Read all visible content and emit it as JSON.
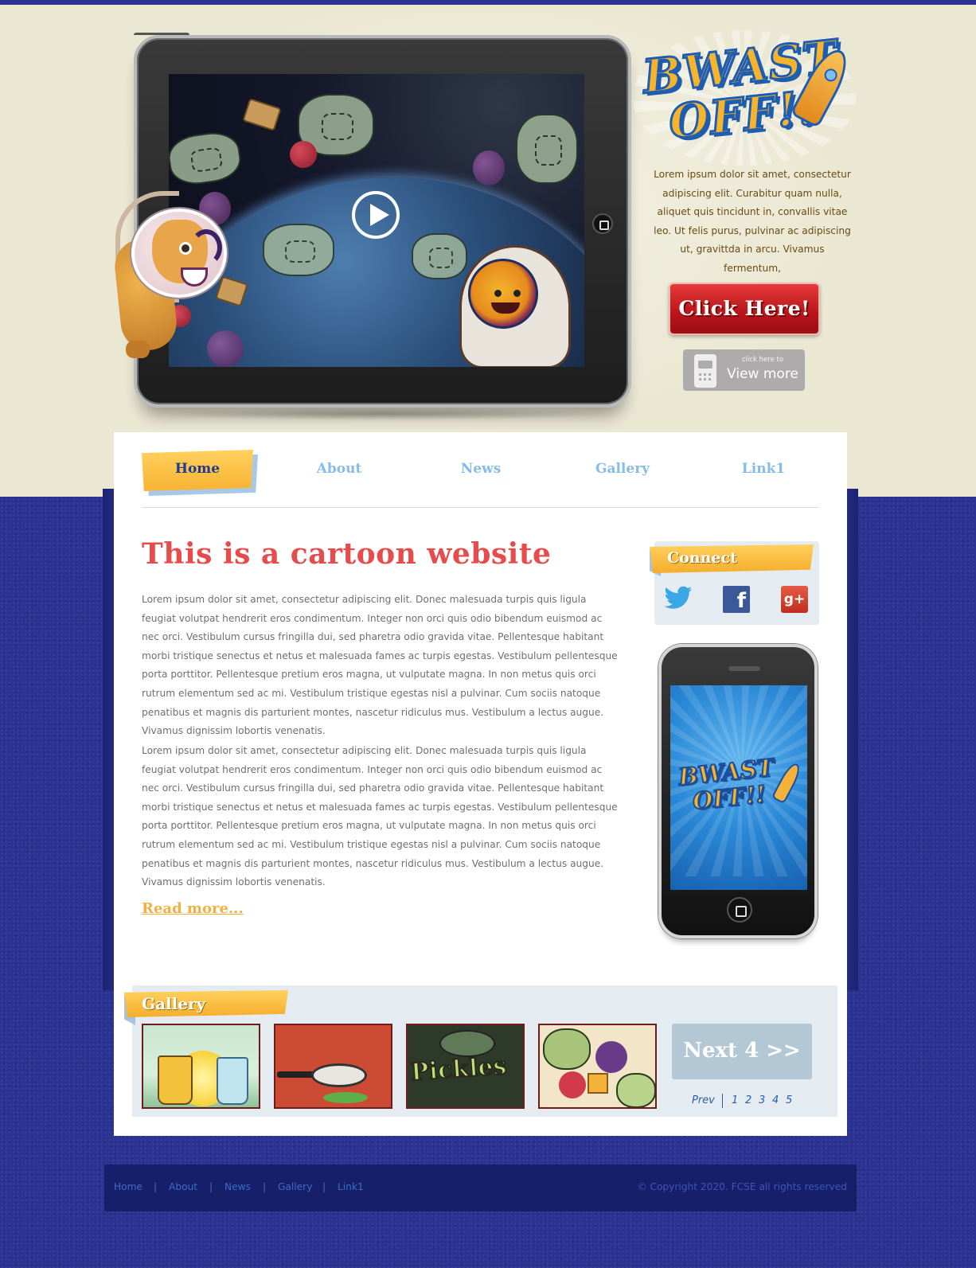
{
  "hero": {
    "logo_line1": "BWAST",
    "logo_line2": "OFF!!",
    "description": "Lorem ipsum dolor sit amet, consectetur adipiscing elit. Curabitur quam nulla, aliquet quis tincidunt in, convallis vitae leo. Ut felis purus, pulvinar ac adipiscing ut, gravittda in arcu. Vivamus fermentum,",
    "click_button": "Click Here!",
    "view_more_small": "click here to",
    "view_more_big": "View more"
  },
  "nav": {
    "items": [
      {
        "label": "Home"
      },
      {
        "label": "About"
      },
      {
        "label": "News"
      },
      {
        "label": "Gallery"
      },
      {
        "label": "Link1"
      }
    ],
    "active": "Home"
  },
  "main": {
    "title": "This is a cartoon website",
    "paragraph1": "Lorem ipsum dolor sit amet, consectetur adipiscing elit. Donec malesuada turpis quis ligula feugiat volutpat hendrerit eros condimentum. Integer non orci quis odio bibendum euismod ac nec orci. Vestibulum cursus fringilla dui, sed pharetra odio gravida vitae. Pellentesque habitant morbi tristique senectus et netus et malesuada fames ac turpis egestas. Vestibulum pellentesque porta porttitor. Pellentesque pretium eros magna, ut vulputate magna. In non metus quis orci rutrum elementum sed ac mi. Vestibulum tristique egestas nisl a pulvinar. Cum sociis natoque penatibus et magnis dis parturient montes, nascetur ridiculus mus. Vestibulum a lectus augue. Vivamus dignissim lobortis venenatis.",
    "paragraph2": "Lorem ipsum dolor sit amet, consectetur adipiscing elit. Donec malesuada turpis quis ligula feugiat volutpat hendrerit eros condimentum. Integer non orci quis odio bibendum euismod ac nec orci. Vestibulum cursus fringilla dui, sed pharetra odio gravida vitae. Pellentesque habitant morbi tristique senectus et netus et malesuada fames ac turpis egestas. Vestibulum pellentesque porta porttitor. Pellentesque pretium eros magna, ut vulputate magna. In non metus quis orci rutrum elementum sed ac mi. Vestibulum tristique egestas nisl a pulvinar. Cum sociis natoque penatibus et magnis dis parturient montes, nascetur ridiculus mus. Vestibulum a lectus augue. Vivamus dignissim lobortis venenatis.",
    "read_more": "Read more..."
  },
  "sidebar": {
    "connect_title": "Connect",
    "social": [
      {
        "name": "twitter-icon"
      },
      {
        "name": "facebook-icon",
        "glyph": "f"
      },
      {
        "name": "google-plus-icon",
        "glyph": "g+"
      }
    ],
    "phone_logo_line1": "BWAST",
    "phone_logo_line2": "OFF!!"
  },
  "gallery": {
    "title": "Gallery",
    "thumb3_text": "Pickles",
    "next_label": "Next 4 >>",
    "prev_label": "Prev",
    "pages": [
      "1",
      "2",
      "3",
      "4",
      "5"
    ]
  },
  "footer": {
    "links": [
      "Home",
      "About",
      "News",
      "Gallery",
      "Link1"
    ],
    "separator": "|",
    "copyright": "© Copyright 2020. FCSE all rights reserved"
  },
  "colors": {
    "background_blue": "#2a3392",
    "hero_cream": "#eae7d2",
    "title_red": "#e74c4c",
    "accent_yellow": "#f7b232",
    "nav_blue": "#85bce8",
    "button_red": "#b8141a",
    "footer_navy": "#16206a"
  }
}
